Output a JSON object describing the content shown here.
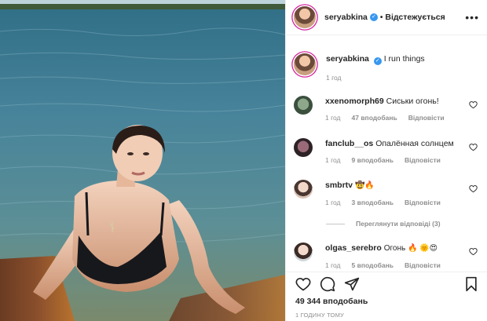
{
  "post": {
    "author": "seryabkina",
    "follow_status": "Відстежується",
    "separator": "•",
    "more_icon": "more-horizontal-icon"
  },
  "caption": {
    "username": "seryabkina",
    "text": "I run things",
    "time": "1 год"
  },
  "comments": [
    {
      "username": "xxenomorph69",
      "text": "Сиськи огонь!",
      "time": "1 год",
      "likes": "47 вподобань",
      "reply": "Відповісти"
    },
    {
      "username": "fanclub__os",
      "text": "Опалённая солнцем",
      "time": "1 год",
      "likes": "9 вподобань",
      "reply": "Відповісти"
    },
    {
      "username": "smbrtv",
      "text": "🤠🔥",
      "time": "1 год",
      "likes": "3 вподобань",
      "reply": "Відповісти"
    },
    {
      "username": "olgas_serebro",
      "text": "Огонь 🔥 🌞😍",
      "time": "1 год",
      "likes": "5 вподобань",
      "reply": "Відповісти"
    }
  ],
  "view_replies": "Переглянути відповіді (3)",
  "stats": {
    "likes_total": "49 344 вподобань",
    "time_ago": "1 ГОДИНУ ТОМУ"
  },
  "colors": {
    "verified": "#3897f0",
    "muted": "#8e8e8e",
    "text": "#262626",
    "border": "#efefef"
  }
}
